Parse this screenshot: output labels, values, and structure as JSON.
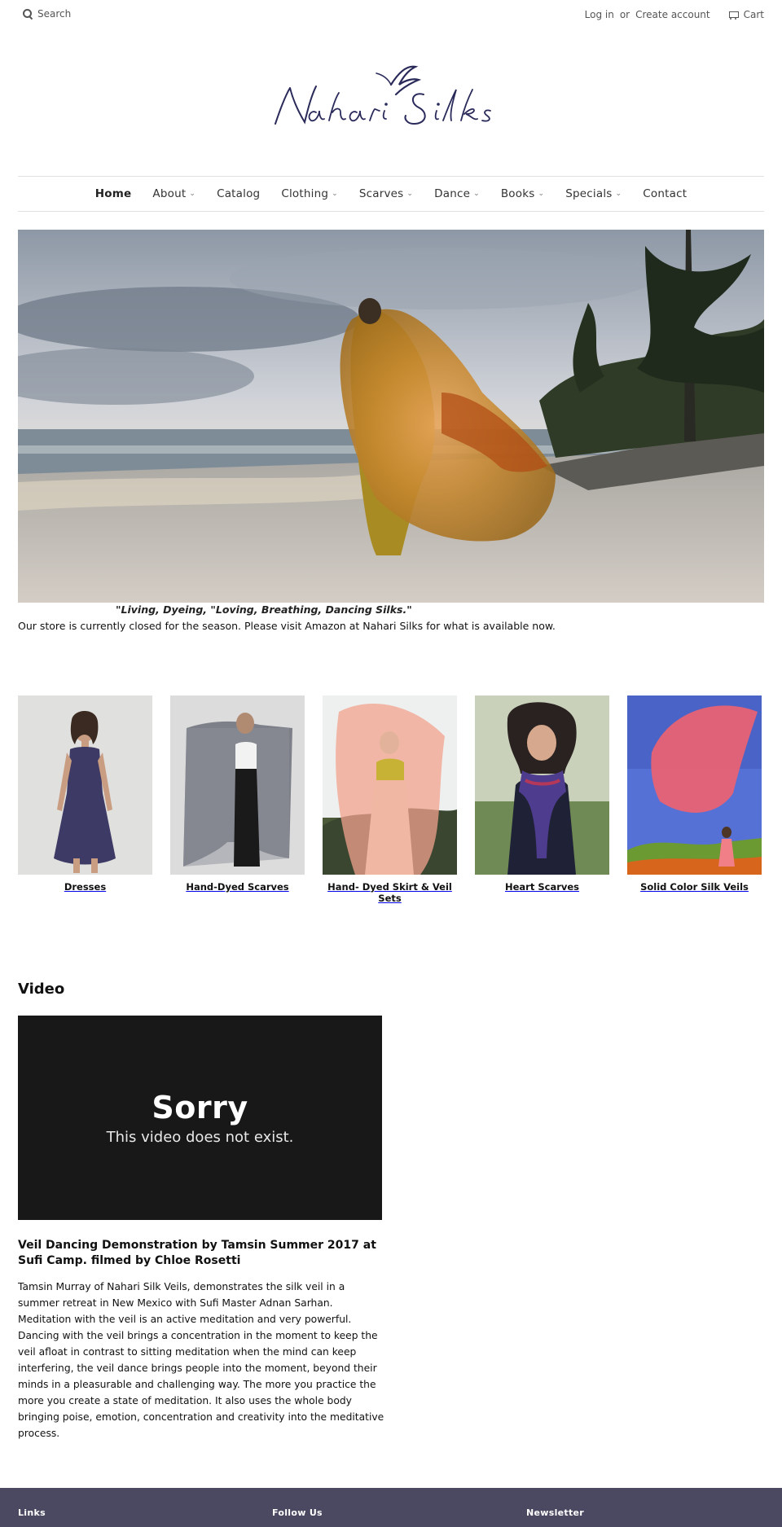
{
  "header": {
    "search_placeholder": "Search",
    "login_label": "Log in",
    "or_label": "or",
    "create_account_label": "Create account",
    "cart_label": "Cart"
  },
  "brand": {
    "name": "Nahari Silks",
    "color": "#2a2a5a"
  },
  "nav": {
    "items": [
      {
        "label": "Home",
        "dropdown": false
      },
      {
        "label": "About",
        "dropdown": true
      },
      {
        "label": "Catalog",
        "dropdown": false
      },
      {
        "label": "Clothing",
        "dropdown": true
      },
      {
        "label": "Scarves",
        "dropdown": true
      },
      {
        "label": "Dance",
        "dropdown": true
      },
      {
        "label": "Books",
        "dropdown": true
      },
      {
        "label": "Specials",
        "dropdown": true
      },
      {
        "label": "Contact",
        "dropdown": false
      }
    ]
  },
  "hero": {
    "tagline": "\"Living, Dyeing, \"Loving, Breathing, Dancing Silks.\"",
    "notice": "Our store is currently closed for the season. Please visit Amazon at Nahari Silks for what is available now."
  },
  "collections": [
    {
      "title": "Dresses"
    },
    {
      "title": "Hand-Dyed Scarves"
    },
    {
      "title": "Hand- Dyed Skirt & Veil Sets"
    },
    {
      "title": "Heart Scarves"
    },
    {
      "title": "Solid Color Silk Veils"
    }
  ],
  "video": {
    "heading": "Video",
    "player_sorry": "Sorry",
    "player_message": "This video does not exist.",
    "title": "Veil Dancing Demonstration by Tamsin Summer 2017 at Sufi Camp. filmed by Chloe Rosetti",
    "description": "Tamsin Murray of Nahari Silk Veils, demonstrates the silk veil in a summer retreat in New Mexico with Sufi Master Adnan Sarhan. Meditation with the veil is an active meditation and very powerful. Dancing with the veil brings a concentration in the moment to keep the veil afloat in contrast to sitting meditation when the mind can keep interfering, the veil dance brings people into the moment, beyond their minds in a pleasurable and challenging way. The more you practice the more you create a state of meditation. It also uses the whole body bringing poise, emotion, concentration and creativity into the meditative process."
  },
  "footer": {
    "links_heading": "Links",
    "follow_heading": "Follow Us",
    "newsletter_heading": "Newsletter",
    "background": "#4b4961"
  }
}
